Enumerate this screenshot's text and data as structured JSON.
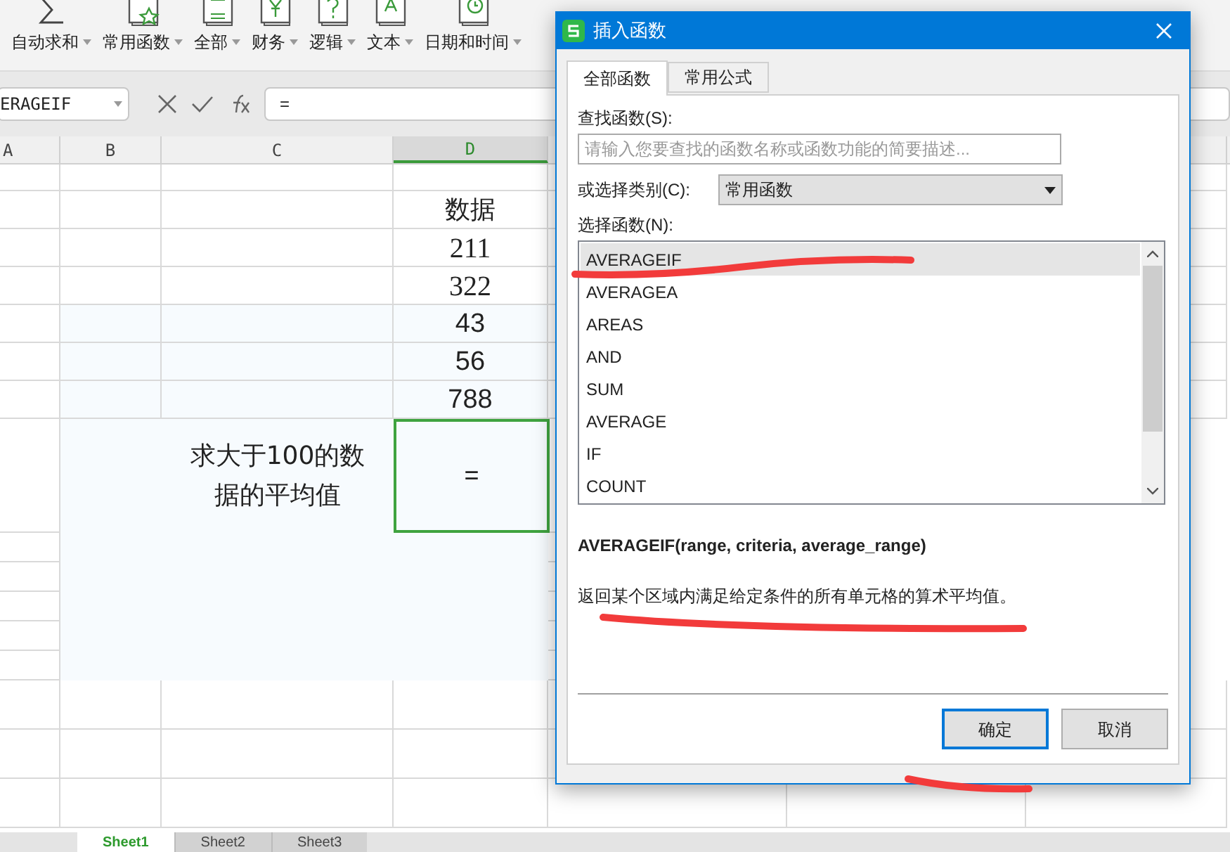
{
  "toolbar": {
    "items": [
      {
        "label": "自动求和",
        "kind": "sigma"
      },
      {
        "label": "常用函数",
        "kind": "star"
      },
      {
        "label": "全部",
        "kind": "fx"
      },
      {
        "label": "财务",
        "kind": "yen"
      },
      {
        "label": "逻辑",
        "kind": "question"
      },
      {
        "label": "文本",
        "kind": "letter"
      },
      {
        "label": "日期和时间",
        "kind": "clock"
      }
    ]
  },
  "formula_bar": {
    "name_box": "ERAGEIF",
    "formula": "="
  },
  "sheet": {
    "columns": [
      "A",
      "B",
      "C",
      "D"
    ],
    "cells": {
      "header": "数据",
      "values": [
        {
          "text": "211",
          "kind": "serif"
        },
        {
          "text": "322",
          "kind": "serif"
        },
        {
          "text": "43",
          "kind": "sans"
        },
        {
          "text": "56",
          "kind": "sans"
        },
        {
          "text": "788",
          "kind": "sans"
        }
      ],
      "question": "求大于100的数据的平均值",
      "answer": "="
    }
  },
  "dialog": {
    "title": "插入函数",
    "tabs": [
      {
        "label": "全部函数",
        "selected": true
      },
      {
        "label": "常用公式",
        "selected": false
      }
    ],
    "search_label": "查找函数(S):",
    "search": {
      "placeholder": "请输入您要查找的函数名称或函数功能的简要描述..."
    },
    "category_label": "或选择类别(C):",
    "category": "常用函数",
    "list_label": "选择函数(N):",
    "functions": [
      {
        "name": "AVERAGEIF",
        "selected": true
      },
      {
        "name": "AVERAGEA",
        "selected": false
      },
      {
        "name": "AREAS",
        "selected": false
      },
      {
        "name": "AND",
        "selected": false
      },
      {
        "name": "SUM",
        "selected": false
      },
      {
        "name": "AVERAGE",
        "selected": false
      },
      {
        "name": "IF",
        "selected": false
      },
      {
        "name": "COUNT",
        "selected": false
      }
    ],
    "signature": "AVERAGEIF(range, criteria, average_range)",
    "description": "返回某个区域内满足给定条件的所有单元格的算术平均值。",
    "buttons": [
      {
        "label": "确定",
        "kind": "default"
      },
      {
        "label": "取消",
        "kind": "normal"
      }
    ]
  },
  "sheet_tabs": [
    {
      "label": "Sheet1",
      "selected": true
    },
    {
      "label": "Sheet2",
      "selected": false
    },
    {
      "label": "Sheet3",
      "selected": false
    }
  ]
}
